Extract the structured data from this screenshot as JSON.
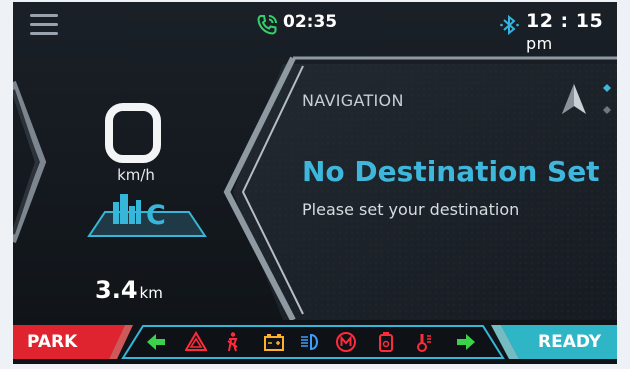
{
  "status_bar": {
    "call_time": "02:35",
    "clock_time": "12 : 15",
    "clock_suffix": "pm"
  },
  "speedometer": {
    "speed": "0",
    "unit": "km/h"
  },
  "drive_mode": {
    "label": "C",
    "icon": "city-mode-icon"
  },
  "odometer": {
    "value": "3.4",
    "unit": "km"
  },
  "navigation": {
    "title": "NAVIGATION",
    "heading": "No Destination Set",
    "subtitle": "Please set your destination"
  },
  "bottom_bar": {
    "gear_left": "PARK",
    "gear_right": "READY",
    "telltales": [
      {
        "name": "left-turn-icon",
        "color": "#3bd24b"
      },
      {
        "name": "hazard-icon",
        "color": "#ff2a3a"
      },
      {
        "name": "seatbelt-icon",
        "color": "#ff2a3a"
      },
      {
        "name": "battery-icon",
        "color": "#ffb02a"
      },
      {
        "name": "headlight-icon",
        "color": "#3aa0ff"
      },
      {
        "name": "motor-warning-icon",
        "color": "#ff2a3a"
      },
      {
        "name": "oil-icon",
        "color": "#ff2a3a"
      },
      {
        "name": "temperature-icon",
        "color": "#ff2a3a"
      },
      {
        "name": "right-turn-icon",
        "color": "#3bd24b"
      }
    ]
  },
  "colors": {
    "accent": "#36b6d8",
    "park": "#e0242f",
    "ready": "#2fb6c6",
    "call": "#36d06a"
  }
}
